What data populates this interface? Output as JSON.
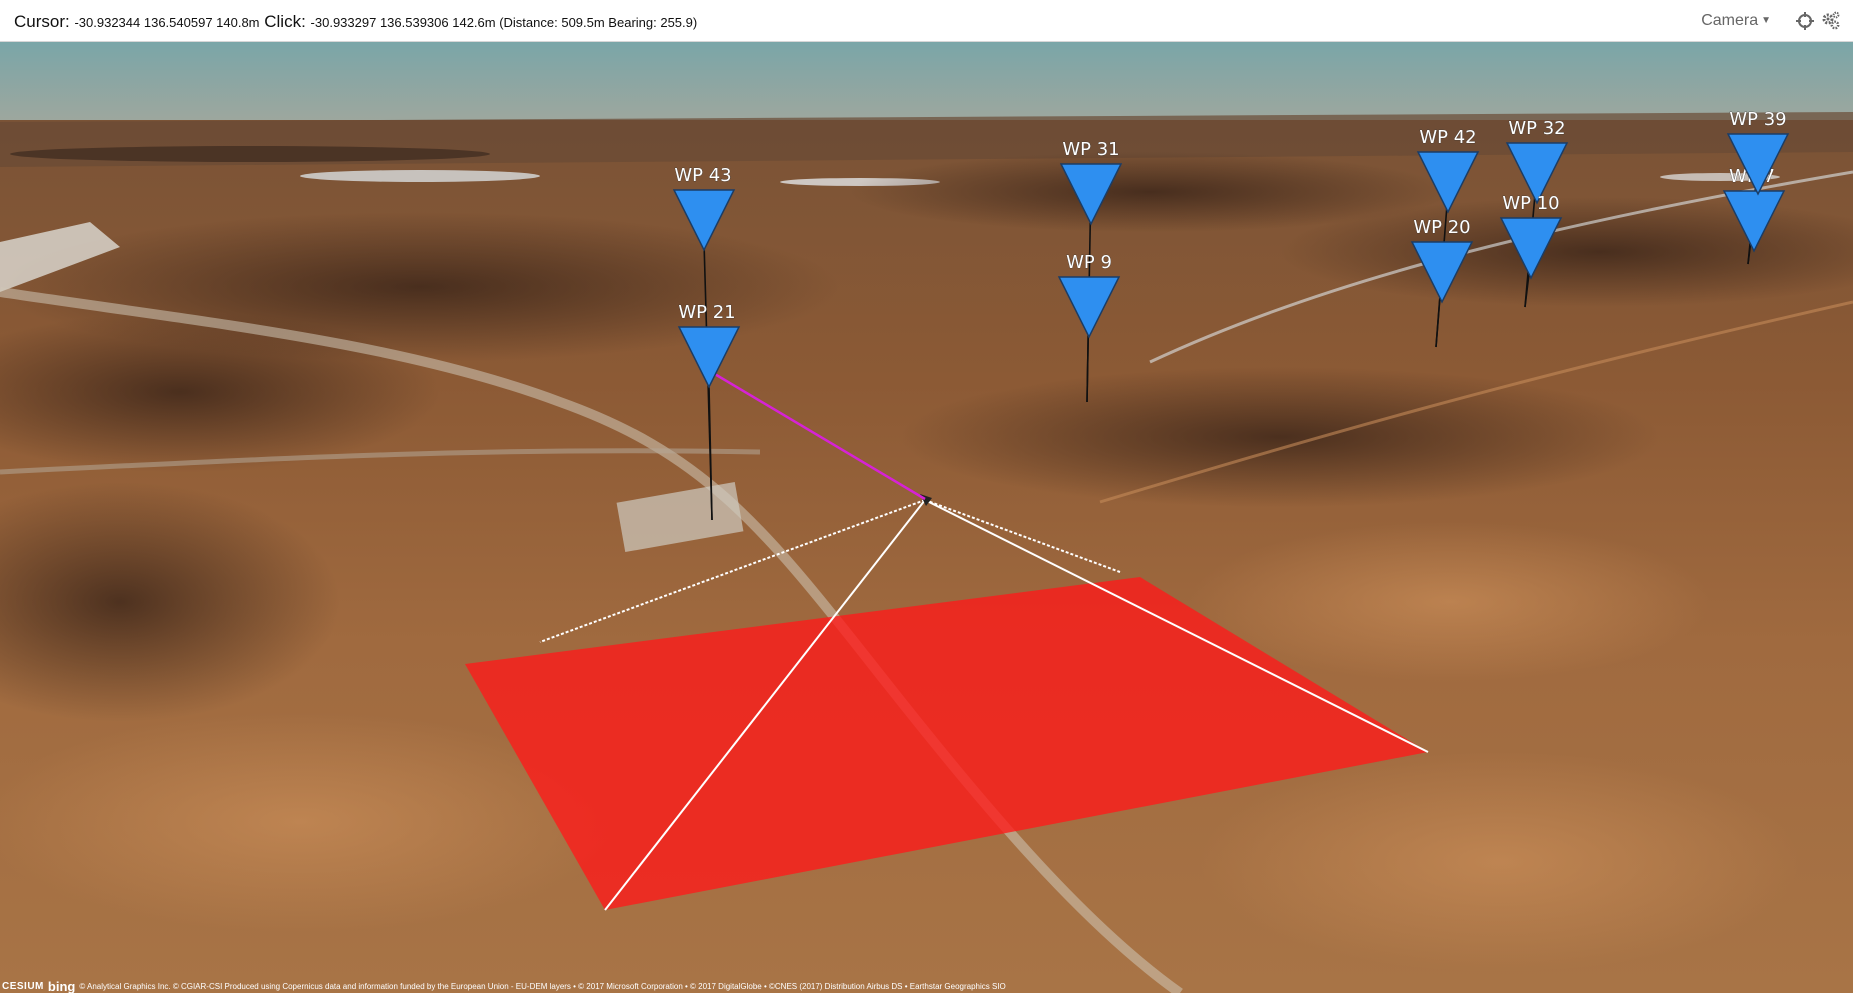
{
  "status_bar": {
    "cursor_label": "Cursor:",
    "cursor_value": "-30.932344 136.540597 140.8m",
    "click_label": "Click:",
    "click_value": "-30.933297 136.539306 142.6m (Distance: 509.5m Bearing: 255.9)"
  },
  "controls": {
    "camera_label": "Camera",
    "icons": [
      "crosshair-icon",
      "gears-icon"
    ]
  },
  "map": {
    "marker_color": "#2e8ff0",
    "measure_line_color": "#d622d6",
    "area_color": "#ff1a1a",
    "waypoints": [
      {
        "id": "wp43",
        "label": "WP 43"
      },
      {
        "id": "wp21",
        "label": "WP 21"
      },
      {
        "id": "wp31",
        "label": "WP 31"
      },
      {
        "id": "wp9",
        "label": "WP 9"
      },
      {
        "id": "wp42",
        "label": "WP 42"
      },
      {
        "id": "wp20",
        "label": "WP 20"
      },
      {
        "id": "wp32",
        "label": "WP 32"
      },
      {
        "id": "wp10",
        "label": "WP 10"
      },
      {
        "id": "wp39",
        "label": "WP 39"
      },
      {
        "id": "wp7",
        "label": "WP 7"
      }
    ]
  },
  "credits": {
    "cesium": "CESIUM",
    "bing": "bing",
    "text": "© Analytical Graphics Inc.  © CGIAR-CSI Produced using Copernicus data and information funded by the European Union - EU-DEM layers • © 2017 Microsoft Corporation • © 2017 DigitalGlobe • ©CNES (2017) Distribution Airbus DS • Earthstar Geographics SIO"
  }
}
